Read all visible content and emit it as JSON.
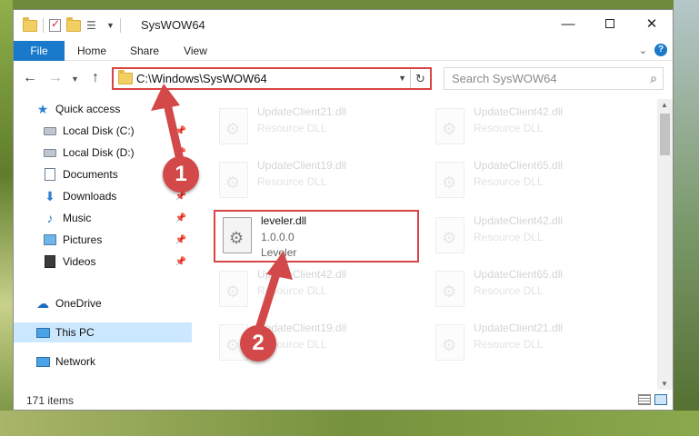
{
  "window": {
    "title": "SysWOW64"
  },
  "ribbon": {
    "tabs": [
      "File",
      "Home",
      "Share",
      "View"
    ]
  },
  "address": {
    "path": "C:\\Windows\\SysWOW64",
    "search_placeholder": "Search SysWOW64"
  },
  "nav": {
    "items": [
      {
        "label": "Quick access",
        "icon": "star-icon",
        "pinned": false
      },
      {
        "label": "Local Disk (C:)",
        "icon": "drive-icon",
        "pinned": true
      },
      {
        "label": "Local Disk (D:)",
        "icon": "drive-icon",
        "pinned": true
      },
      {
        "label": "Documents",
        "icon": "documents-icon",
        "pinned": true
      },
      {
        "label": "Downloads",
        "icon": "downloads-icon",
        "pinned": true
      },
      {
        "label": "Music",
        "icon": "music-icon",
        "pinned": true
      },
      {
        "label": "Pictures",
        "icon": "pictures-icon",
        "pinned": true
      },
      {
        "label": "Videos",
        "icon": "videos-icon",
        "pinned": true
      },
      {
        "label": "OneDrive",
        "icon": "cloud-icon",
        "pinned": false
      },
      {
        "label": "This PC",
        "icon": "computer-icon",
        "pinned": false,
        "selected": true
      },
      {
        "label": "Network",
        "icon": "network-icon",
        "pinned": false
      }
    ]
  },
  "files": [
    {
      "name": "UpdateClient21.dll",
      "line2": "Resource DLL",
      "line3": "",
      "dim": true
    },
    {
      "name": "UpdateClient42.dll",
      "line2": "Resource DLL",
      "line3": "",
      "dim": true
    },
    {
      "name": "UpdateClient19.dll",
      "line2": "Resource DLL",
      "line3": "",
      "dim": true
    },
    {
      "name": "UpdateClient65.dll",
      "line2": "Resource DLL",
      "line3": "",
      "dim": true
    },
    {
      "name": "leveler.dll",
      "line2": "1.0.0.0",
      "line3": "Leveler",
      "dim": false
    },
    {
      "name": "UpdateClient42.dll",
      "line2": "Resource DLL",
      "line3": "",
      "dim": true
    },
    {
      "name": "UpdateClient42.dll",
      "line2": "Resource DLL",
      "line3": "",
      "dim": true
    },
    {
      "name": "UpdateClient65.dll",
      "line2": "Resource DLL",
      "line3": "",
      "dim": true
    },
    {
      "name": "UpdateClient19.dll",
      "line2": "Resource DLL",
      "line3": "",
      "dim": true
    },
    {
      "name": "UpdateClient21.dll",
      "line2": "Resource DLL",
      "line3": "",
      "dim": true
    }
  ],
  "status": {
    "item_count": "171 items"
  },
  "annotations": {
    "marker_1": "1",
    "marker_2": "2",
    "color": "#d34848"
  },
  "colors": {
    "accent": "#1979ca",
    "selection": "#cce8ff",
    "highlight_border": "#d84343"
  }
}
